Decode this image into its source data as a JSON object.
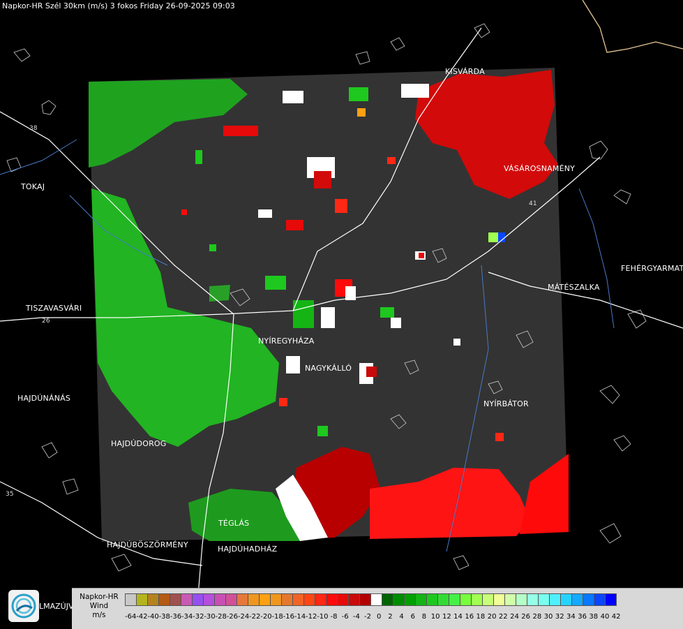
{
  "title": "Napkor-HR Szél 30km (m/s) 3 fokos Friday 26-09-2025 09:03",
  "cities": [
    {
      "name": "KISVÁRDA"
    },
    {
      "name": "VÁSÁROSNAMÉNY"
    },
    {
      "name": "TOKAJ"
    },
    {
      "name": "FEHÉRGYARMAT"
    },
    {
      "name": "MÁTÉSZALKA"
    },
    {
      "name": "TISZAVASVÁRI"
    },
    {
      "name": "NYÍREGYHÁZA"
    },
    {
      "name": "NAGYKÁLLÓ"
    },
    {
      "name": "HAJDÚNÁNÁS"
    },
    {
      "name": "NYÍRBÁTOR"
    },
    {
      "name": "HAJDÚDOROG"
    },
    {
      "name": "TÉGLÁS"
    },
    {
      "name": "HAJDÚBÖSZÖRMÉNY"
    },
    {
      "name": "HAJDÚHADHÁZ"
    }
  ],
  "road_numbers": [
    "38",
    "41",
    "26",
    "35"
  ],
  "cut_label": "LMAZÚJVÁR",
  "logo": {
    "icon": "weather-logo-icon"
  },
  "legend": {
    "title_lines": [
      "Napkor-HR",
      "Wind",
      "m/s"
    ],
    "colors": [
      "#c8c8c8",
      "#b4b41e",
      "#b4821e",
      "#b45a14",
      "#a05050",
      "#c85ab4",
      "#9650f0",
      "#b450dc",
      "#c850b4",
      "#d25096",
      "#e6783c",
      "#f0961e",
      "#ffa014",
      "#f0961e",
      "#e6782d",
      "#f06428",
      "#ff4614",
      "#ff2814",
      "#ff0a0a",
      "#e60a0a",
      "#c80a0a",
      "#b40000",
      "#ffffff",
      "#006400",
      "#008c00",
      "#00a000",
      "#14b414",
      "#1ec81e",
      "#32dc32",
      "#46f046",
      "#78ff3c",
      "#a0ff50",
      "#c8ff78",
      "#f0ff96",
      "#d2ffaa",
      "#b4ffc8",
      "#96ffe6",
      "#78fff0",
      "#50f0ff",
      "#28d2ff",
      "#14aaff",
      "#0a78ff",
      "#0a46ff",
      "#0000ff"
    ],
    "ticks": [
      "-64",
      "-42",
      "-40",
      "-38",
      "-36",
      "-34",
      "-32",
      "-30",
      "-28",
      "-26",
      "-24",
      "-22",
      "-20",
      "-18",
      "-16",
      "-14",
      "-12",
      "-10",
      "-8",
      "-6",
      "-4",
      "-2",
      "0",
      "2",
      "4",
      "6",
      "8",
      "10",
      "12",
      "14",
      "16",
      "18",
      "20",
      "22",
      "24",
      "26",
      "28",
      "30",
      "32",
      "34",
      "36",
      "38",
      "40",
      "42"
    ]
  }
}
